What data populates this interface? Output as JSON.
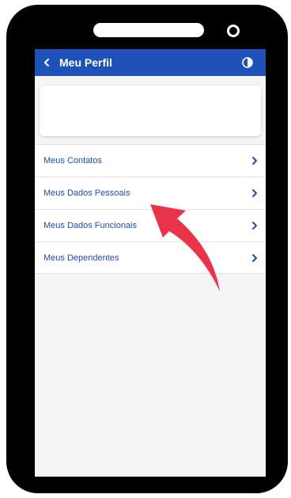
{
  "header": {
    "title": "Meu Perfil",
    "back_icon": "chevron-left-icon",
    "theme_icon": "contrast-icon"
  },
  "menu": {
    "items": [
      {
        "label": "Meus Contatos"
      },
      {
        "label": "Meus Dados Pessoais"
      },
      {
        "label": "Meus Dados Funcionais"
      },
      {
        "label": "Meus Dependentes"
      }
    ]
  },
  "colors": {
    "appbar": "#1f52b8",
    "link_text": "#1f4da8",
    "annotation_arrow": "#e8334a",
    "device_frame": "#000000"
  }
}
